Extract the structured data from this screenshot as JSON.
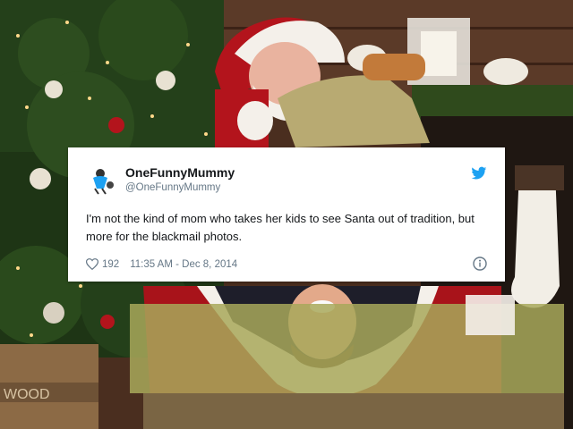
{
  "tweet": {
    "display_name": "OneFunnyMummy",
    "handle": "@OneFunnyMummy",
    "text": "I'm not the kind of mom who takes her kids to see Santa out of tradition, but more for the blackmail photos.",
    "likes": "192",
    "timestamp": "11:35 AM - Dec 8, 2014"
  },
  "background_sign": "WOOD",
  "icons": [
    "avatar-icon",
    "twitter-bird-icon",
    "heart-icon",
    "info-icon"
  ],
  "colors": {
    "twitter_blue": "#1da1f2",
    "santa_red": "#b3141c",
    "card": "#ffffff",
    "secondary_text": "#657786"
  }
}
